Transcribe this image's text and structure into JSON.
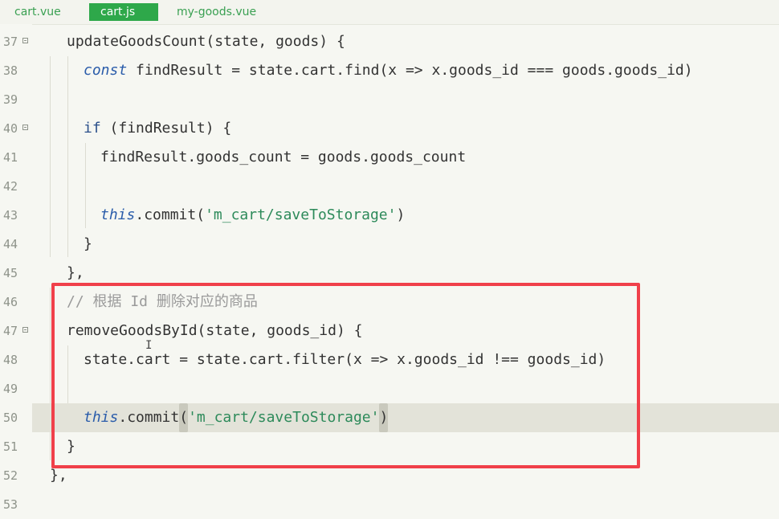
{
  "tabs": [
    {
      "label": "cart.vue"
    },
    {
      "label": "cart.js",
      "active": true
    },
    {
      "label": "my-goods.vue"
    }
  ],
  "lines": [
    {
      "num": "37",
      "fold": true
    },
    {
      "num": "38"
    },
    {
      "num": "39"
    },
    {
      "num": "40",
      "fold": true
    },
    {
      "num": "41"
    },
    {
      "num": "42"
    },
    {
      "num": "43"
    },
    {
      "num": "44"
    },
    {
      "num": "45"
    },
    {
      "num": "46"
    },
    {
      "num": "47",
      "fold": true
    },
    {
      "num": "48"
    },
    {
      "num": "49"
    },
    {
      "num": "50"
    },
    {
      "num": "51"
    },
    {
      "num": "52"
    },
    {
      "num": "53"
    }
  ],
  "code": {
    "l37": "updateGoodsCount(state, goods) {",
    "l38_kw": "const",
    "l38_rest": " findResult = state.cart.find(x => x.goods_id === goods.goods_id)",
    "l40_kw": "if",
    "l40_rest": " (findResult) {",
    "l41": "findResult.goods_count = goods.goods_count",
    "l43_kw": "this",
    "l43_mid": ".commit(",
    "l43_str": "'m_cart/saveToStorage'",
    "l43_end": ")",
    "l44": "}",
    "l45": "},",
    "l46": "// 根据 Id 删除对应的商品",
    "l47": "removeGoodsById(state, goods_id) {",
    "l48": "state.cart = state.cart.filter(x => x.goods_id !== goods_id)",
    "l50_kw": "this",
    "l50_mid": ".commit",
    "l50_open": "(",
    "l50_str": "'m_cart/saveToStorage'",
    "l50_close": ")",
    "l51": "}",
    "l52": "},"
  },
  "colors": {
    "tab_active_bg": "#2ea84a",
    "highlight_box": "#f0404a",
    "keyword": "#2a5caa",
    "string": "#2d8a5a",
    "comment": "#9a9a9a"
  }
}
